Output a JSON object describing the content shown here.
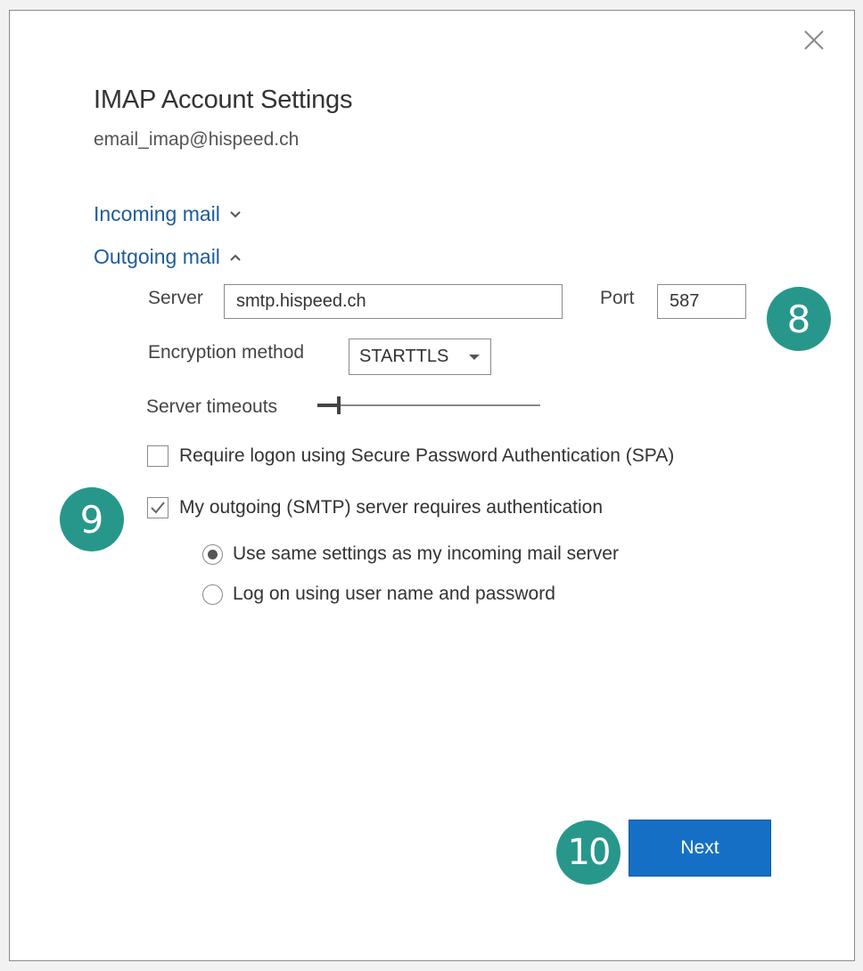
{
  "dialog": {
    "title": "IMAP Account Settings",
    "account": "email_imap@hispeed.ch",
    "close_icon": "close-icon"
  },
  "sections": {
    "incoming": {
      "label": "Incoming mail",
      "icon": "chevron-down-icon"
    },
    "outgoing": {
      "label": "Outgoing mail",
      "icon": "chevron-up-icon"
    }
  },
  "outgoing": {
    "server_label": "Server",
    "server_value": "smtp.hispeed.ch",
    "port_label": "Port",
    "port_value": "587",
    "encryption_label": "Encryption method",
    "encryption_value": "STARTTLS",
    "timeout_label": "Server timeouts",
    "spa_label": "Require logon using Secure Password Authentication (SPA)",
    "spa_checked": false,
    "smtp_auth_label": "My outgoing (SMTP) server requires authentication",
    "smtp_auth_checked": true,
    "radio_same_label": "Use same settings as my incoming mail server",
    "radio_logon_label": "Log on using user name and password",
    "selected_radio": "same"
  },
  "footer": {
    "next_label": "Next"
  },
  "badges": {
    "b8": "8",
    "b9": "9",
    "b10": "10"
  },
  "colors": {
    "accent": "#1570c5",
    "badge": "#27978c",
    "link": "#1f5c99"
  }
}
